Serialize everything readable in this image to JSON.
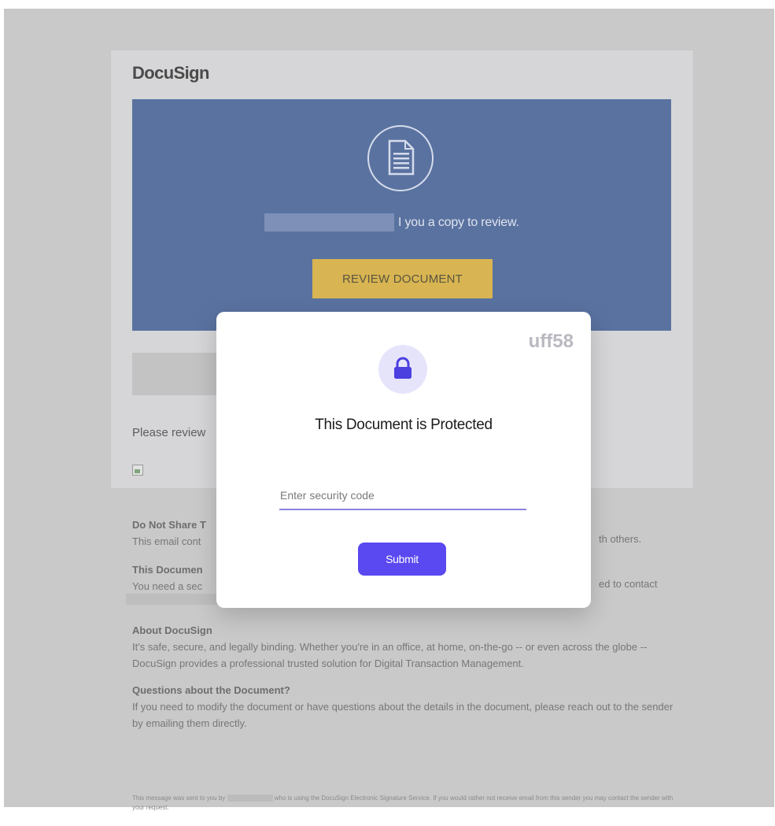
{
  "email": {
    "brand": "DocuSign",
    "banner_message": "I you a copy to review.",
    "review_button": "REVIEW DOCUMENT",
    "please_review": "Please review",
    "colors": {
      "banner": "#5a72a0",
      "review_button": "#d8b552"
    }
  },
  "info": {
    "do_not_share_heading": "Do Not Share T",
    "do_not_share_text": "This email cont",
    "do_not_share_tail": "th others.",
    "this_document_heading": "This Documen",
    "this_document_text": "You need a sec",
    "this_document_tail": "ed to contact",
    "about_heading": "About DocuSign",
    "about_text": "It's safe, secure, and legally binding. Whether you're in an office, at home, on-the-go -- or even across the globe -- DocuSign provides a professional trusted solution for Digital Transaction Management.",
    "questions_heading": "Questions about the Document?",
    "questions_text": "If you need to modify the document or have questions about the details in the document, please reach out to the sender by emailing them directly.",
    "footer_part1": "This message was sent to you by",
    "footer_part2": "who is using the DocuSign Electronic Signature Service. If you would rather not receive email from this sender you may contact the sender with your request."
  },
  "modal": {
    "code": "uff58",
    "title": "This Document is Protected",
    "input_placeholder": "Enter security code",
    "submit_label": "Submit",
    "colors": {
      "accent": "#5a48f0",
      "lock_bg": "#e6e4fb"
    }
  }
}
